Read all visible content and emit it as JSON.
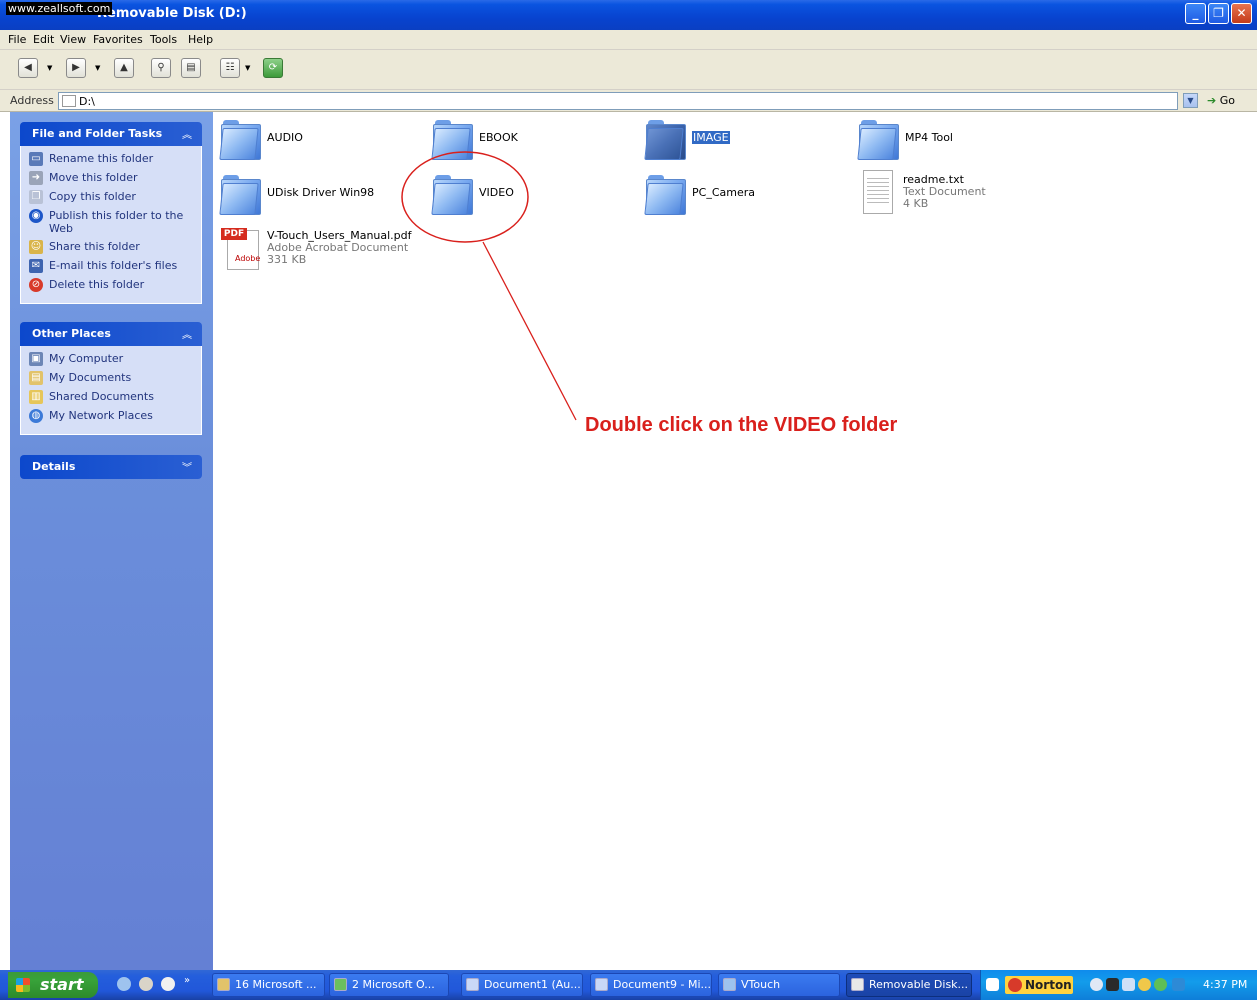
{
  "window": {
    "title": "Removable Disk (D:)",
    "watermark": "www.zeallsoft.com"
  },
  "menu": [
    "File",
    "Edit",
    "View",
    "Favorites",
    "Tools",
    "Help"
  ],
  "address": {
    "label": "Address",
    "value": "D:\\",
    "go_label": "Go"
  },
  "sidebar": {
    "file_tasks": {
      "title": "File and Folder Tasks",
      "items": [
        {
          "label": "Rename this folder",
          "icon": "rename-icon"
        },
        {
          "label": "Move this folder",
          "icon": "move-icon"
        },
        {
          "label": "Copy this folder",
          "icon": "copy-icon"
        },
        {
          "label": "Publish this folder to the Web",
          "icon": "globe-icon"
        },
        {
          "label": "Share this folder",
          "icon": "share-icon"
        },
        {
          "label": "E-mail this folder's files",
          "icon": "email-icon"
        },
        {
          "label": "Delete this folder",
          "icon": "delete-icon"
        }
      ]
    },
    "other_places": {
      "title": "Other Places",
      "items": [
        {
          "label": "My Computer",
          "icon": "computer-icon"
        },
        {
          "label": "My Documents",
          "icon": "documents-icon"
        },
        {
          "label": "Shared Documents",
          "icon": "shared-folder-icon"
        },
        {
          "label": "My Network Places",
          "icon": "network-icon"
        }
      ]
    },
    "details": {
      "title": "Details"
    }
  },
  "files": [
    {
      "name": "AUDIO",
      "type": "folder"
    },
    {
      "name": "EBOOK",
      "type": "folder"
    },
    {
      "name": "IMAGE",
      "type": "folder",
      "selected": true
    },
    {
      "name": "MP4 Tool",
      "type": "folder"
    },
    {
      "name": "UDisk Driver Win98",
      "type": "folder"
    },
    {
      "name": "VIDEO",
      "type": "folder"
    },
    {
      "name": "PC_Camera",
      "type": "folder"
    },
    {
      "name": "readme.txt",
      "type": "file",
      "kind": "Text Document",
      "size": "4 KB"
    },
    {
      "name": "V-Touch_Users_Manual.pdf",
      "type": "file",
      "kind": "Adobe Acrobat Document",
      "size": "331 KB",
      "icon_tag": "PDF",
      "icon_caption": "Adobe"
    }
  ],
  "annotation": {
    "text": "Double click on the VIDEO folder",
    "color": "#d9201c"
  },
  "taskbar": {
    "start_label": "start",
    "buttons": [
      "16 Microsoft ...",
      "2 Microsoft O...",
      "Document1 (Au...",
      "Document9 - Mi...",
      "VTouch",
      "Removable Disk..."
    ],
    "norton_label": "Norton",
    "clock": "4:37 PM"
  },
  "colors": {
    "titlebar": "#0a54e0",
    "sidebar_bg": "#6b8fdb",
    "selection": "#316ac5"
  }
}
